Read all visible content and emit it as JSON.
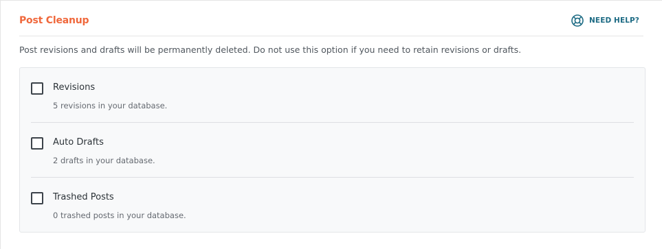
{
  "header": {
    "title": "Post Cleanup",
    "help_label": "NEED HELP?",
    "help_icon": "lifebuoy-icon",
    "accent_color": "#f0683c",
    "help_color": "#1d6b84"
  },
  "description": "Post revisions and drafts will be permanently deleted. Do not use this option if you need to retain revisions or drafts.",
  "options": [
    {
      "label": "Revisions",
      "detail": "5 revisions in your database.",
      "checked": false
    },
    {
      "label": "Auto Drafts",
      "detail": "2 drafts in your database.",
      "checked": false
    },
    {
      "label": "Trashed Posts",
      "detail": "0 trashed posts in your database.",
      "checked": false
    }
  ]
}
